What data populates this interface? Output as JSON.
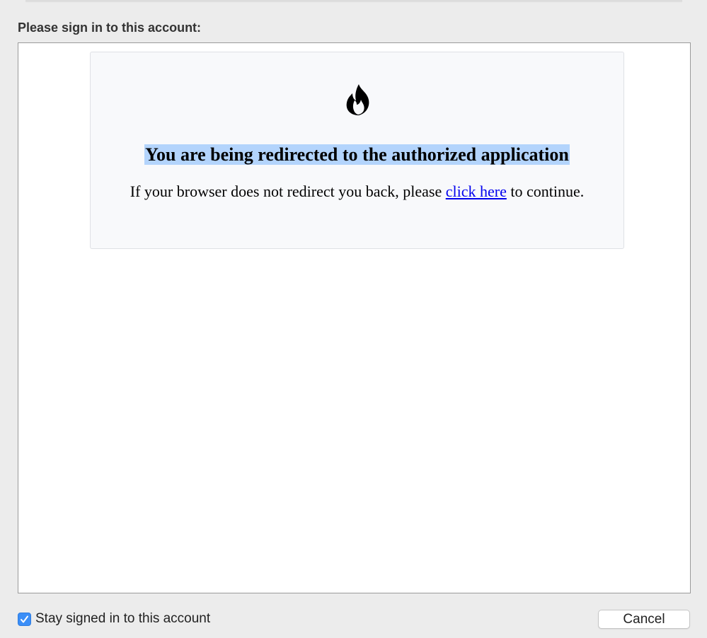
{
  "dialog": {
    "prompt": "Please sign in to this account:"
  },
  "page": {
    "icon": "flame-icon",
    "headline": "You are being redirected to the authorized application",
    "subline_before": "If your browser does not redirect you back, please ",
    "link_text": "click here",
    "subline_after": " to continue."
  },
  "footer": {
    "stay_signed_in_label": "Stay signed in to this account",
    "stay_signed_in_checked": true,
    "cancel_label": "Cancel"
  },
  "colors": {
    "checkbox": "#3b8ef7",
    "link": "#0000ee",
    "selection": "#b3d4fc"
  }
}
